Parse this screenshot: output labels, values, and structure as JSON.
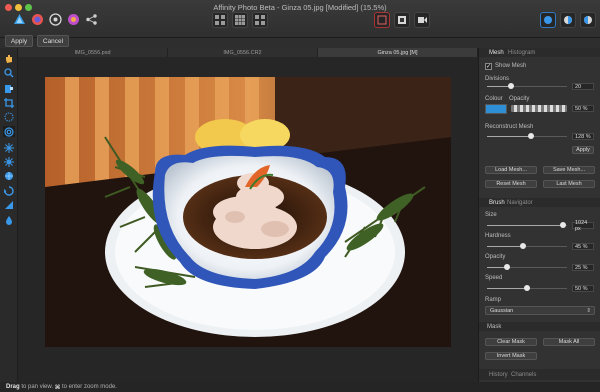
{
  "window": {
    "title": "Affinity Photo Beta - Ginza 05.jpg [Modified] (15.5%)"
  },
  "icons": {
    "personas": [
      "photo-persona-icon",
      "liquify-persona-icon",
      "develop-persona-icon",
      "tone-map-persona-icon",
      "export-persona-icon"
    ],
    "tools": [
      "hand-icon",
      "zoom-icon",
      "paint-brush-icon",
      "crop-icon",
      "selection-brush-icon",
      "brush-icon",
      "clone-icon",
      "burn-icon",
      "dodge-icon",
      "sponge-icon",
      "liquify-icon",
      "flood-fill-icon"
    ]
  },
  "context_toolbar": {
    "apply_label": "Apply",
    "cancel_label": "Cancel"
  },
  "document_tabs": [
    "IMG_0556.psd",
    "IMG_0556.CR2",
    "Ginza 05.jpg [M]"
  ],
  "canvas": {
    "image_description_hidden": ""
  },
  "mesh_panel": {
    "tabs": [
      "Mesh",
      "Histogram"
    ],
    "show_mesh_label": "Show Mesh",
    "show_mesh_checked": true,
    "divisions_label": "Divisions",
    "divisions_value": "20",
    "divisions_level": 0.3,
    "colour_label": "Colour",
    "colour_value": "#2f8fd6",
    "opacity_label": "Opacity",
    "opacity_value": "50 %",
    "reconstruct_label": "Reconstruct Mesh",
    "reconstruct_value": "128 %",
    "reconstruct_level": 0.55,
    "apply_label": "Apply",
    "load_mesh": "Load Mesh...",
    "save_mesh": "Save Mesh...",
    "reset_mesh": "Reset Mesh",
    "last_mesh": "Last Mesh"
  },
  "brush_panel": {
    "tabs": [
      "Brush",
      "Navigator"
    ],
    "size_label": "Size",
    "size_value": "1024 px",
    "size_level": 0.95,
    "hardness_label": "Hardness",
    "hardness_value": "45 %",
    "hardness_level": 0.45,
    "opacity_label": "Opacity",
    "opacity_value": "25 %",
    "opacity_level": 0.25,
    "speed_label": "Speed",
    "speed_value": "50 %",
    "speed_level": 0.5,
    "ramp_label": "Ramp",
    "ramp_value": "Gaussian"
  },
  "mask_panel": {
    "header": "Mask",
    "clear_mask": "Clear Mask",
    "mask_all": "Mask All",
    "invert_mask": "Invert Mask"
  },
  "bottom_tabs": [
    "History",
    "Channels"
  ],
  "status": {
    "drag": "Drag",
    "drag_text": " to pan view. ",
    "key": "⌘",
    "key_text": " to enter zoom mode."
  }
}
